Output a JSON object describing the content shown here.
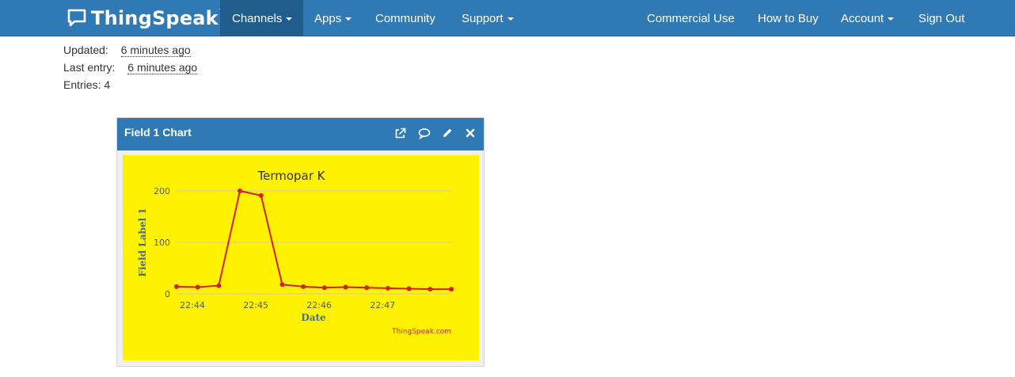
{
  "navbar": {
    "brand": "ThingSpeak",
    "brand_tm": "™",
    "left_items": [
      {
        "label": "Channels",
        "caret": true,
        "active": true
      },
      {
        "label": "Apps",
        "caret": true
      },
      {
        "label": "Community",
        "caret": false
      },
      {
        "label": "Support",
        "caret": true
      }
    ],
    "right_items": [
      {
        "label": "Commercial Use",
        "caret": false
      },
      {
        "label": "How to Buy",
        "caret": false
      },
      {
        "label": "Account",
        "caret": true
      },
      {
        "label": "Sign Out",
        "caret": false
      }
    ]
  },
  "info": {
    "updated_label": "Updated:",
    "updated_value": "6 minutes ago",
    "last_entry_label": "Last entry:",
    "last_entry_value": "6 minutes ago",
    "entries_label": "Entries:",
    "entries_value": "4"
  },
  "panel": {
    "title": "Field 1 Chart",
    "icons": [
      "external-link-icon",
      "comment-icon",
      "pencil-icon",
      "close-icon"
    ]
  },
  "chart_data": {
    "type": "line",
    "title": "Termopar K",
    "xlabel": "Date",
    "ylabel": "Field Label 1",
    "credit": "ThingSpeak.com",
    "x_ticks": [
      "22:44",
      "22:45",
      "22:46",
      "22:47"
    ],
    "y_ticks": [
      0,
      100,
      200
    ],
    "ylim": [
      0,
      200
    ],
    "grid": true,
    "background": "#fff200",
    "line_color": "#d62020",
    "series": [
      {
        "x": [
          "22:43:45",
          "22:44:05",
          "22:44:25",
          "22:44:45",
          "22:45:05",
          "22:45:25",
          "22:45:45",
          "22:46:05",
          "22:46:25",
          "22:46:45",
          "22:47:05",
          "22:47:25",
          "22:47:45",
          "22:48:05"
        ],
        "values": [
          14,
          13,
          16,
          200,
          191,
          18,
          14,
          12,
          13,
          12,
          11,
          10,
          9,
          9
        ]
      }
    ]
  }
}
